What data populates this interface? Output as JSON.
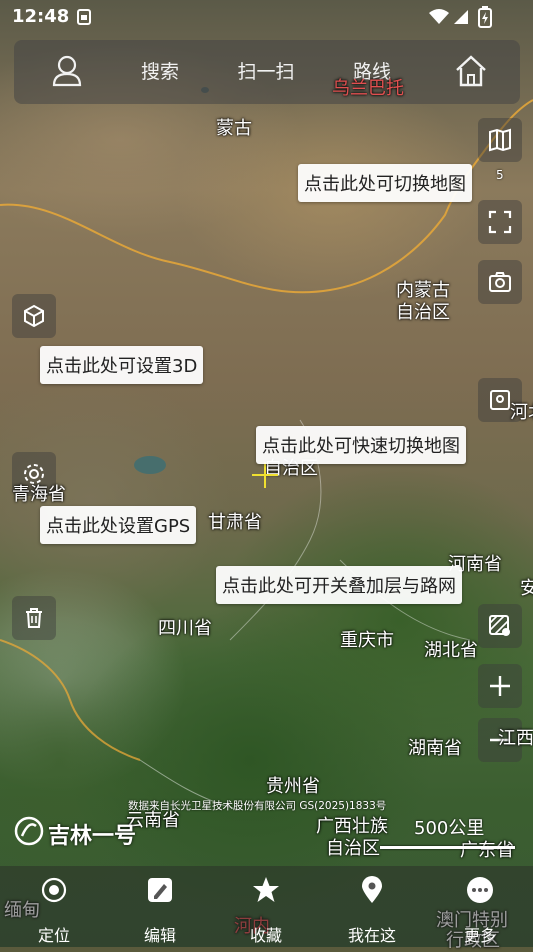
{
  "status_bar": {
    "time": "12:48",
    "extra_icon": "sim-card-icon"
  },
  "top_bar": {
    "search": "搜索",
    "scan": "扫一扫",
    "route": "路线"
  },
  "tips": {
    "switch_map": "点击此处可切换地图",
    "set_3d": "点击此处可设置3D",
    "quick_switch": "点击此处可快速切换地图",
    "set_gps": "点击此处设置GPS",
    "layers": "点击此处可开关叠加层与路网"
  },
  "map_labels": {
    "mongolia": "蒙古",
    "ulanbator": "乌兰巴托",
    "inner_mongolia_1": "内蒙古",
    "inner_mongolia_2": "自治区",
    "qinghai": "青海省",
    "gansu": "甘肃省",
    "ningxia": "自治区",
    "henan": "河南省",
    "sichuan": "四川省",
    "chongqing": "重庆市",
    "hubei": "湖北省",
    "hunan": "湖南省",
    "guizhou": "贵州省",
    "yunnan": "云南省",
    "guangxi_1": "广西壮族",
    "guangxi_2": "自治区",
    "guangdong": "广东省",
    "jiangxi": "江西",
    "hebei": "河北",
    "myanmar": "缅甸",
    "macao_1": "澳门特别",
    "macao_2": "行政区",
    "hanoi": "河内",
    "an": "安"
  },
  "side_badge": "5",
  "attribution": "数据来自长光卫星技术股份有限公司 GS(2025)1833号",
  "brand": "吉林一号",
  "scale": "500公里",
  "bottom_nav": [
    {
      "label": "定位",
      "icon": "locate-icon"
    },
    {
      "label": "编辑",
      "icon": "edit-icon"
    },
    {
      "label": "收藏",
      "icon": "star-icon"
    },
    {
      "label": "我在这",
      "icon": "pin-icon"
    },
    {
      "label": "更多",
      "icon": "more-icon"
    }
  ],
  "colors": {
    "boundary": "#e8a838",
    "accent_red": "#e05050"
  }
}
